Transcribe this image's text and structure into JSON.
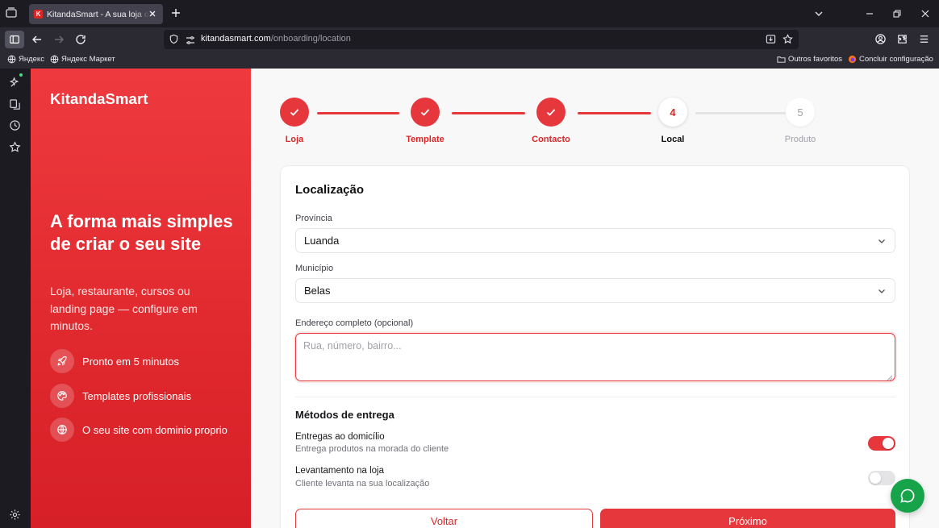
{
  "browser": {
    "tab": {
      "title": "KitandaSmart - A sua loja online",
      "favicon_letter": "K"
    },
    "url": {
      "domain": "kitandasmart.com",
      "path": "/onboarding/location"
    },
    "bookmarks": {
      "left": [
        {
          "label": "Яндекс",
          "icon": "globe-icon"
        },
        {
          "label": "Яндекс Маркет",
          "icon": "globe-icon"
        }
      ],
      "right": [
        {
          "label": "Outros favoritos",
          "icon": "folder-icon"
        },
        {
          "label": "Concluir configuração",
          "icon": "firefox-icon"
        }
      ]
    },
    "side_rail_icons": [
      "ai-sparkle-icon",
      "sidebar-history-icon",
      "clock-icon",
      "star-icon",
      "settings-icon"
    ]
  },
  "left_panel": {
    "brand": "KitandaSmart",
    "headline": "A forma mais simples de criar o seu site",
    "subtitle": "Loja, restaurante, cursos ou landing page — configure em minutos.",
    "features": [
      {
        "icon": "rocket-icon",
        "label": "Pronto em 5 minutos"
      },
      {
        "icon": "palette-icon",
        "label": "Templates profissionais"
      },
      {
        "icon": "globe-icon",
        "label": "O seu site com dominio proprio"
      }
    ]
  },
  "stepper": {
    "steps": [
      {
        "number": "1",
        "label": "Loja",
        "state": "done"
      },
      {
        "number": "2",
        "label": "Template",
        "state": "done"
      },
      {
        "number": "3",
        "label": "Contacto",
        "state": "done"
      },
      {
        "number": "4",
        "label": "Local",
        "state": "current"
      },
      {
        "number": "5",
        "label": "Produto",
        "state": "pending"
      }
    ]
  },
  "form": {
    "title": "Localização",
    "province": {
      "label": "Província",
      "value": "Luanda"
    },
    "municipality": {
      "label": "Município",
      "value": "Belas"
    },
    "address": {
      "label": "Endereço completo (opcional)",
      "placeholder": "Rua, número, bairro..."
    },
    "delivery": {
      "title": "Métodos de entrega",
      "options": [
        {
          "title": "Entregas ao domicílio",
          "description": "Entrega produtos na morada do cliente",
          "enabled": true
        },
        {
          "title": "Levantamento na loja",
          "description": "Cliente levanta na sua localização",
          "enabled": false
        }
      ]
    },
    "back_label": "Voltar",
    "next_label": "Próximo"
  },
  "colors": {
    "accent": "#e5373c",
    "whatsapp": "#16a34a"
  }
}
